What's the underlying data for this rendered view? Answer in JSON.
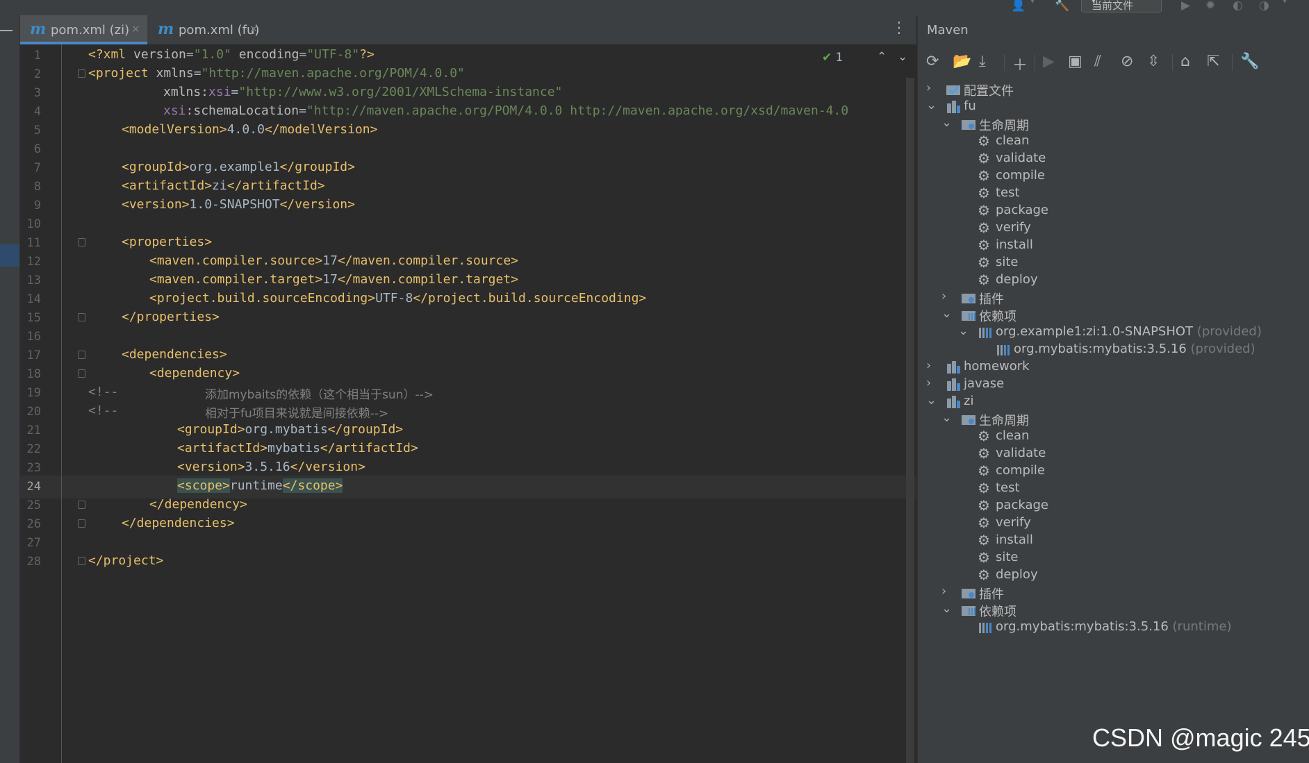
{
  "toolbar": {
    "run_config": "当前文件"
  },
  "tabs": [
    {
      "label": "pom.xml (zi)",
      "active": true
    },
    {
      "label": "pom.xml (fu)",
      "active": false
    }
  ],
  "editor": {
    "inspection_count": "1",
    "current_line": 24,
    "lines": [
      "1",
      "2",
      "3",
      "4",
      "5",
      "6",
      "7",
      "8",
      "9",
      "10",
      "11",
      "12",
      "13",
      "14",
      "15",
      "16",
      "17",
      "18",
      "19",
      "20",
      "21",
      "22",
      "23",
      "24",
      "25",
      "26",
      "27",
      "28"
    ],
    "code": {
      "l1a": "<?xml ",
      "l1b": "version",
      "l1c": "=",
      "l1d": "\"1.0\"",
      "l1e": " encoding",
      "l1f": "=",
      "l1g": "\"UTF-8\"",
      "l1h": "?>",
      "l2a": "<project ",
      "l2b": "xmlns",
      "l2c": "=",
      "l2d": "\"http://maven.apache.org/POM/4.0.0\"",
      "l3a": "xmlns:",
      "l3b": "xsi",
      "l3c": "=",
      "l3d": "\"http://www.w3.org/2001/XMLSchema-instance\"",
      "l4a": "xsi",
      "l4b": ":schemaLocation",
      "l4c": "=",
      "l4d": "\"http://maven.apache.org/POM/4.0.0 http://maven.apache.org/xsd/maven-4.0",
      "l5a": "<modelVersion>",
      "l5b": "4.0.0",
      "l5c": "</modelVersion>",
      "l7a": "<groupId>",
      "l7b": "org.example1",
      "l7c": "</groupId>",
      "l8a": "<artifactId>",
      "l8b": "zi",
      "l8c": "</artifactId>",
      "l9a": "<version>",
      "l9b": "1.0-SNAPSHOT",
      "l9c": "</version>",
      "l11a": "<properties>",
      "l12a": "<maven.compiler.source>",
      "l12b": "17",
      "l12c": "</maven.compiler.source>",
      "l13a": "<maven.compiler.target>",
      "l13b": "17",
      "l13c": "</maven.compiler.target>",
      "l14a": "<project.build.sourceEncoding>",
      "l14b": "UTF-8",
      "l14c": "</project.build.sourceEncoding>",
      "l15a": "</properties>",
      "l17a": "<dependencies>",
      "l18a": "<dependency>",
      "l19a": "<!--",
      "l19b": "添加mybaits的依赖（这个相当于sun）-->",
      "l20a": "<!--",
      "l20b": "相对于fu项目来说就是间接依赖-->",
      "l21a": "<groupId>",
      "l21b": "org.mybatis",
      "l21c": "</groupId>",
      "l22a": "<artifactId>",
      "l22b": "mybatis",
      "l22c": "</artifactId>",
      "l23a": "<version>",
      "l23b": "3.5.16",
      "l23c": "</version>",
      "l24a": "<scope>",
      "l24b": "runtime",
      "l24c": "</scope>",
      "l25a": "</dependency>",
      "l26a": "</dependencies>",
      "l28a": "</project>"
    }
  },
  "maven": {
    "title": "Maven",
    "config_files": "配置文件",
    "fu": {
      "name": "fu",
      "lifecycle": "生命周期",
      "goals": [
        "clean",
        "validate",
        "compile",
        "test",
        "package",
        "verify",
        "install",
        "site",
        "deploy"
      ],
      "plugins": "插件",
      "deps": "依赖项",
      "dep1": "org.example1:zi:1.0-SNAPSHOT",
      "dep1_scope": "(provided)",
      "dep2": "org.mybatis:mybatis:3.5.16",
      "dep2_scope": "(provided)"
    },
    "homework": "homework",
    "javase": "javase",
    "zi": {
      "name": "zi",
      "lifecycle": "生命周期",
      "goals": [
        "clean",
        "validate",
        "compile",
        "test",
        "package",
        "verify",
        "install",
        "site",
        "deploy"
      ],
      "plugins": "插件",
      "deps": "依赖项",
      "dep1": "org.mybatis:mybatis:3.5.16",
      "dep1_scope": "(runtime)"
    }
  },
  "watermark": "CSDN @magic 245",
  "colors": {
    "accent": "#4a88c7",
    "tag": "#e8bf6a",
    "string": "#6a8759",
    "namespace": "#9876aa",
    "comment": "#808080"
  }
}
